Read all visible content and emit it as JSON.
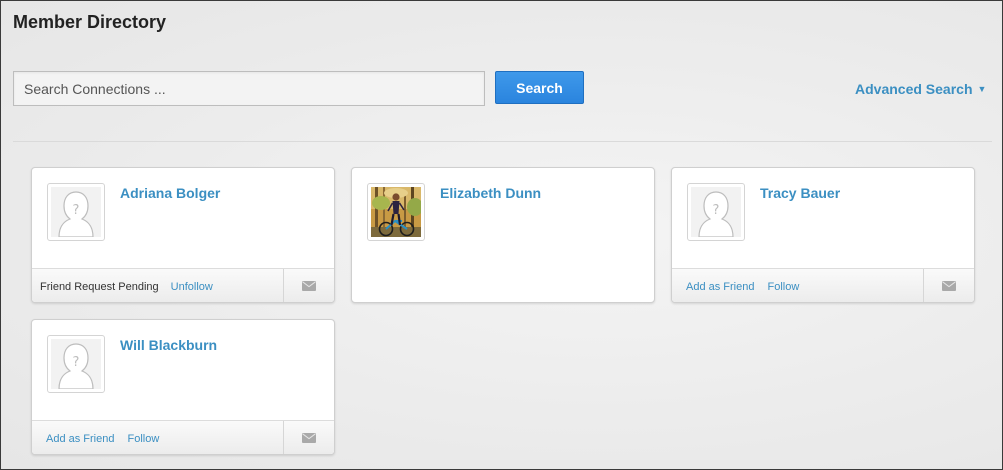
{
  "page": {
    "title": "Member Directory"
  },
  "search": {
    "placeholder": "Search Connections ...",
    "value": "",
    "button_label": "Search",
    "advanced_label": "Advanced Search"
  },
  "colors": {
    "link": "#3b8fc2",
    "search_button": "#2f8ce6"
  },
  "members": [
    {
      "name": "Adriana Bolger",
      "avatar": "placeholder-avatar",
      "status": "Friend Request Pending",
      "actions": [
        "Unfollow"
      ],
      "has_footer": true
    },
    {
      "name": "Elizabeth Dunn",
      "avatar": "photo-avatar",
      "status": "",
      "actions": [],
      "has_footer": false
    },
    {
      "name": "Tracy Bauer",
      "avatar": "placeholder-avatar",
      "status": "",
      "actions": [
        "Add as Friend",
        "Follow"
      ],
      "has_footer": true
    },
    {
      "name": "Will Blackburn",
      "avatar": "placeholder-avatar",
      "status": "",
      "actions": [
        "Add as Friend",
        "Follow"
      ],
      "has_footer": true
    }
  ],
  "icons": {
    "message": "mail-icon",
    "placeholder": "unknown-person-icon"
  }
}
